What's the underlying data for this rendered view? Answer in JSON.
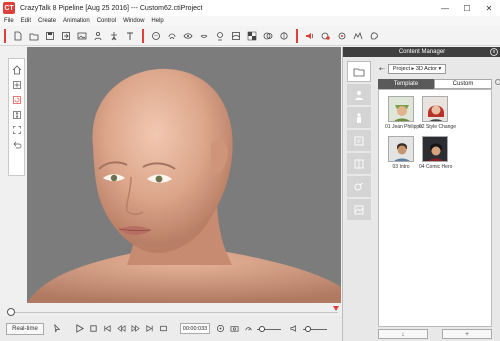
{
  "window": {
    "title": "CrazyTalk 8 Pipeline [Aug 25 2016] --- Custom62.ctiProject",
    "logo": "CT",
    "minimize": "—",
    "maximize": "☐",
    "close": "✕"
  },
  "menu": [
    "File",
    "Edit",
    "Create",
    "Animation",
    "Control",
    "Window",
    "Help"
  ],
  "toolbar": {
    "icons": [
      "new-file-icon",
      "open-folder-icon",
      "save-icon",
      "export-icon",
      "image-icon",
      "character-icon",
      "rig-icon",
      "text-icon",
      "face-icon",
      "hair-icon",
      "eye-icon",
      "mouth-icon",
      "head-icon",
      "smoothing-icon",
      "checker-icon",
      "mask-icon",
      "morph-icon",
      "audio-icon",
      "record-icon",
      "puppet-icon",
      "puppet2-icon"
    ],
    "accent": "#e0403a"
  },
  "left_tools": [
    "home-icon",
    "move-icon",
    "rotate-icon",
    "zoom-icon",
    "fit-icon",
    "undo-icon"
  ],
  "playback": {
    "realtime_label": "Real-time",
    "timecode": "00:00:033"
  },
  "content_manager": {
    "title": "Content Manager",
    "close": "x",
    "crumb_back": "⇠",
    "crumb": [
      "Project",
      "3D Actor"
    ],
    "tabs": {
      "template": "Template",
      "custom": "Custom"
    },
    "items": [
      {
        "label": "01 Jean Philippe"
      },
      {
        "label": "02 Style Change"
      },
      {
        "label": "03 Intro"
      },
      {
        "label": "04 Comic Hero"
      }
    ],
    "bottom": {
      "left": "↓",
      "right": "+"
    }
  }
}
